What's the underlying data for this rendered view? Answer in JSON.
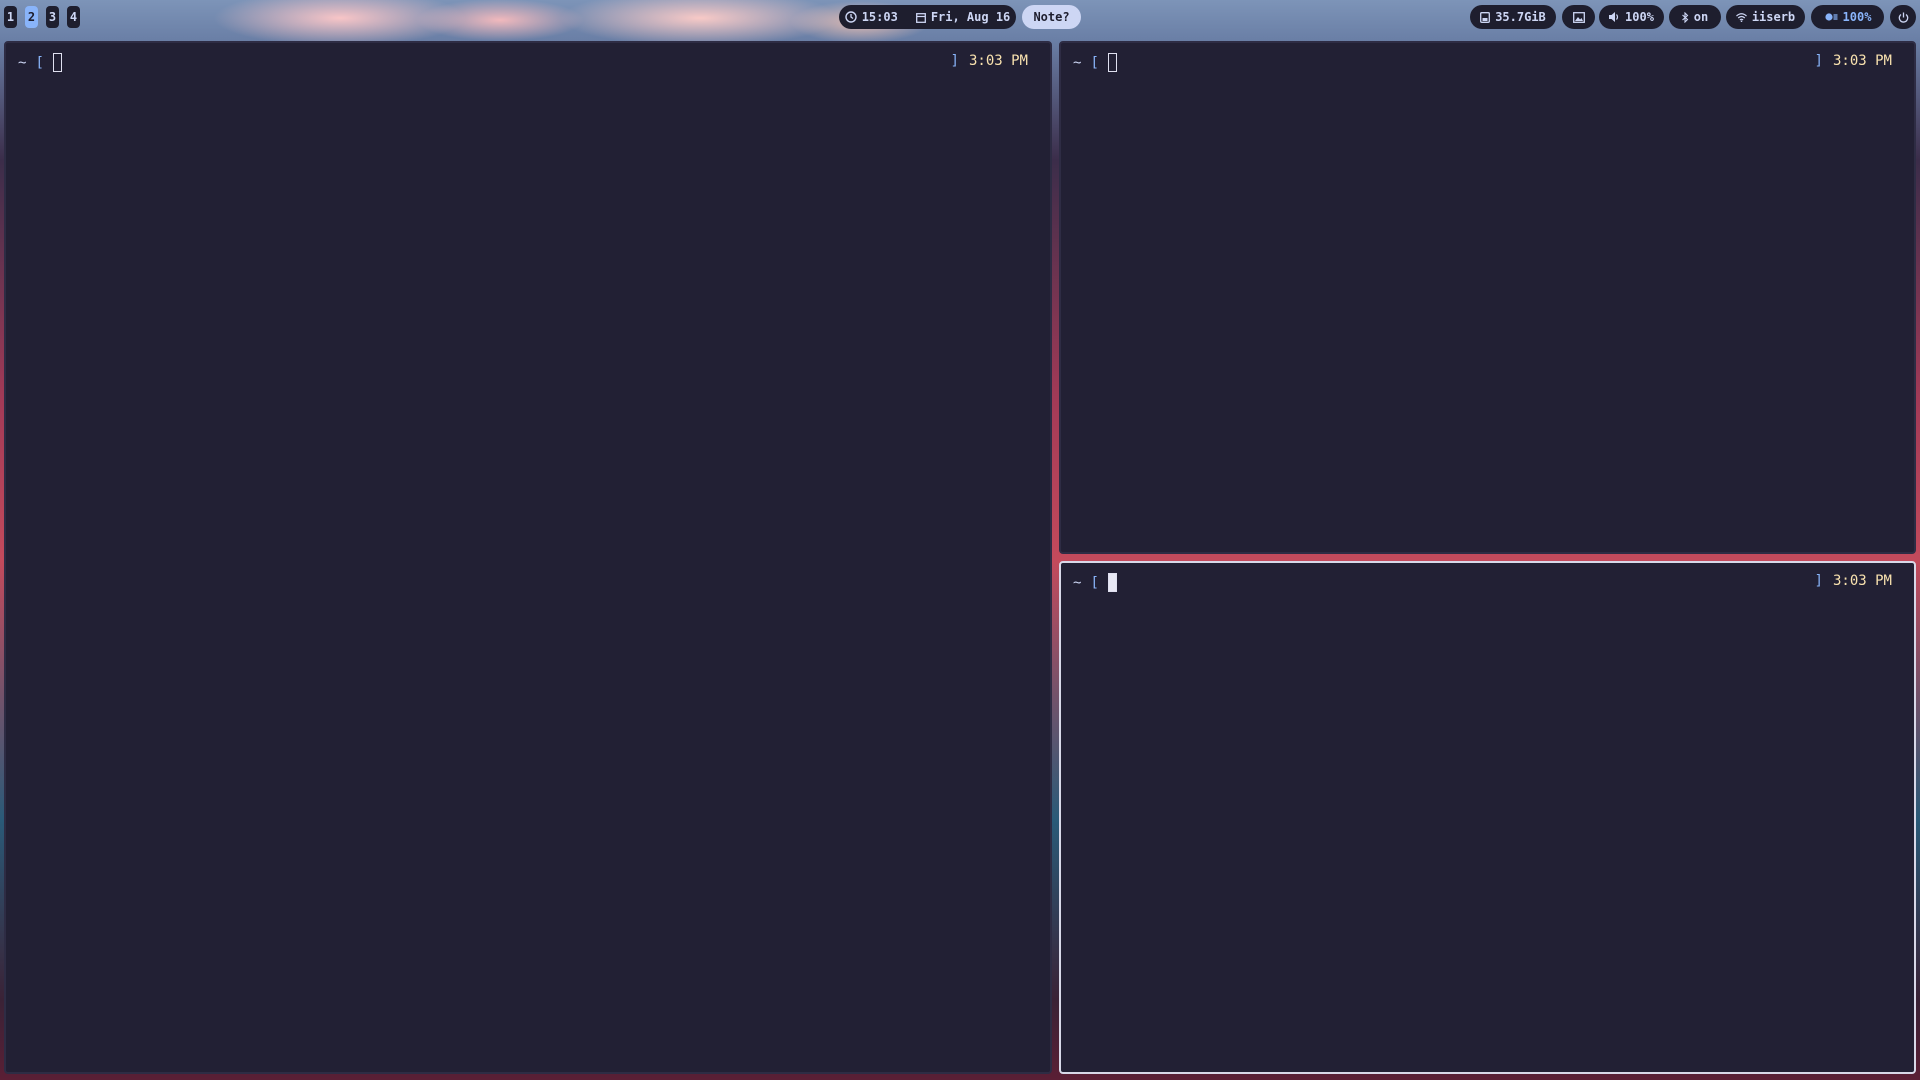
{
  "workspaces": [
    "1",
    "2",
    "3",
    "4"
  ],
  "active_workspace": "2",
  "clock": {
    "time": "15:03",
    "date": "Fri, Aug 16",
    "clock_icon": "clock-icon",
    "calendar_icon": "calendar-icon"
  },
  "note_button": {
    "label": "Note?"
  },
  "status": {
    "disk": {
      "icon": "disk-icon",
      "value": "35.7GiB"
    },
    "wallpaper": {
      "icon": "image-icon"
    },
    "volume": {
      "icon": "speaker-icon",
      "value": "100%"
    },
    "bluetooth": {
      "icon": "bluetooth-icon",
      "value": "on"
    },
    "wifi": {
      "icon": "wifi-icon",
      "value": "iiserb"
    },
    "brightness": {
      "icon": "brightness-icon",
      "value": "100%"
    },
    "power": {
      "icon": "power-icon"
    }
  },
  "terminals": [
    {
      "prompt_home": "~",
      "prompt_open": "[",
      "prompt_close": "]",
      "time": "3:03 PM"
    },
    {
      "prompt_home": "~",
      "prompt_open": "[",
      "prompt_close": "]",
      "time": "3:03 PM"
    },
    {
      "prompt_home": "~",
      "prompt_open": "[",
      "prompt_close": "]",
      "time": "3:03 PM"
    }
  ],
  "colors": {
    "bar_bg": "#1e1e2e",
    "accent": "#89b4fa",
    "terminal_bg": "#222034",
    "time_text": "#f9e2af",
    "text": "#cdd6f4"
  }
}
